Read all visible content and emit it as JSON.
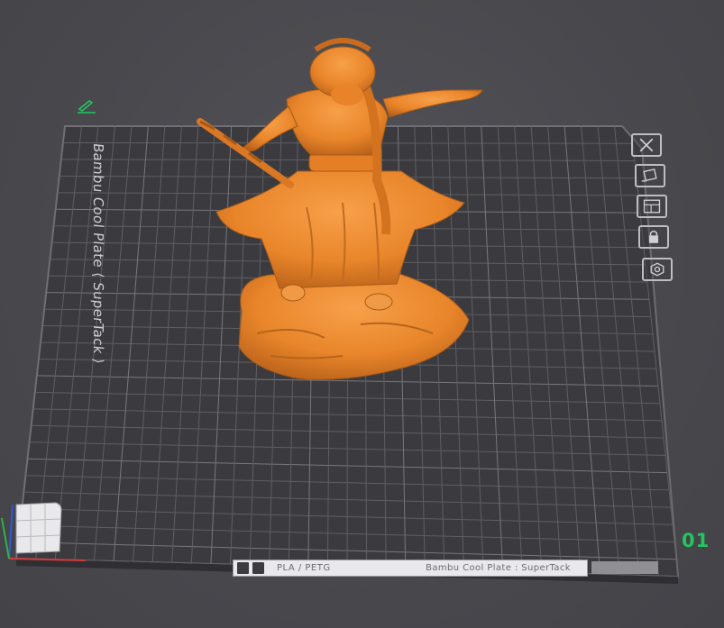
{
  "viewport": {
    "plate_label": "Bambu Cool Plate ⟨ SuperTack ⟩",
    "plate_number": "01",
    "status_strip": {
      "material": "PLA / PETG",
      "plate_name": "Bambu Cool Plate : SuperTack"
    }
  },
  "toolbar": {
    "items": [
      {
        "icon": "close-icon"
      },
      {
        "icon": "auto-orient-icon"
      },
      {
        "icon": "arrange-icon"
      },
      {
        "icon": "lock-icon"
      },
      {
        "icon": "plate-settings-icon"
      }
    ]
  },
  "colors": {
    "model": "#f08a2c",
    "plate": "#3b3b40",
    "grid": "#5f5f65",
    "plate_number": "#22c55e"
  }
}
